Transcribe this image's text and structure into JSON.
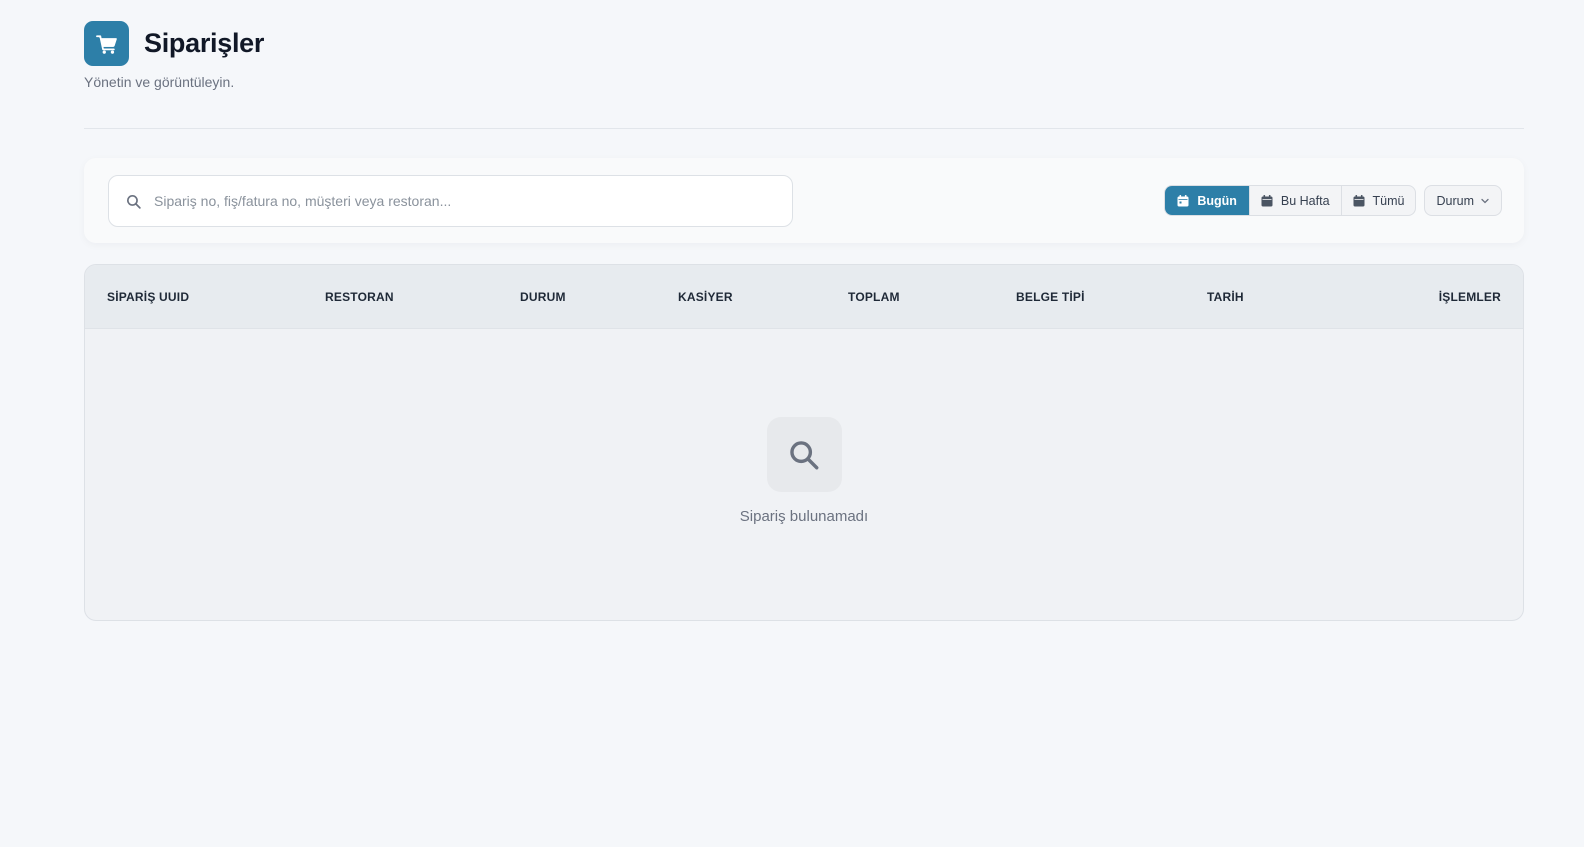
{
  "header": {
    "title": "Siparişler",
    "subtitle": "Yönetin ve görüntüleyin.",
    "logo_icon": "shopping-cart-icon",
    "accent_color": "#2d7fa8"
  },
  "search": {
    "placeholder": "Sipariş no, fiş/fatura no, müşteri veya restoran...",
    "value": "",
    "icon": "search-icon"
  },
  "filters": {
    "date_range": [
      {
        "label": "Bugün",
        "icon": "calendar-icon",
        "active": true
      },
      {
        "label": "Bu Hafta",
        "icon": "calendar-icon",
        "active": false
      },
      {
        "label": "Tümü",
        "icon": "calendar-icon",
        "active": false
      }
    ],
    "status_select": {
      "label": "Durum",
      "icon": "chevron-down-icon"
    }
  },
  "table": {
    "columns": [
      "SİPARİŞ UUID",
      "RESTORAN",
      "DURUM",
      "KASİYER",
      "TOPLAM",
      "BELGE TİPİ",
      "TARİH",
      "İŞLEMLER"
    ],
    "rows": [],
    "empty_icon": "search-icon",
    "empty_message": "Sipariş bulunamadı"
  }
}
